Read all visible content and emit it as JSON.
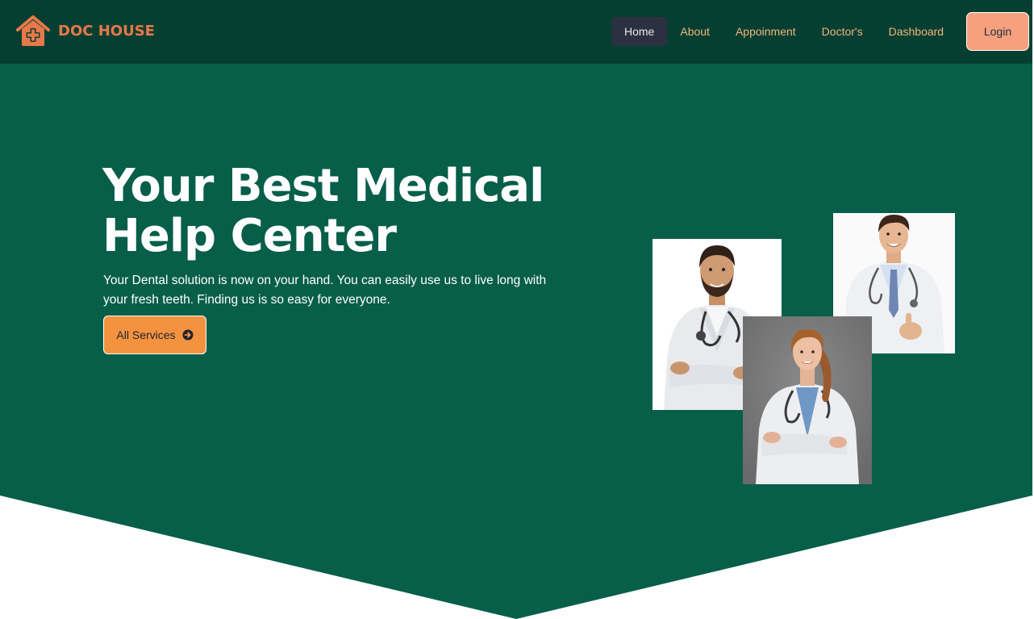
{
  "brand": {
    "name": "DOC HOUSE",
    "logo_icon": "house-plus-icon"
  },
  "nav": {
    "items": [
      {
        "label": "Home",
        "active": true
      },
      {
        "label": "About",
        "active": false
      },
      {
        "label": "Appoinment",
        "active": false
      },
      {
        "label": "Doctor's",
        "active": false
      },
      {
        "label": "Dashboard",
        "active": false
      }
    ],
    "login_label": "Login"
  },
  "hero": {
    "title_line1": "Your Best Medical",
    "title_line2": "Help Center",
    "description": "Your Dental solution is now on your hand. You can easily use us to live long with your fresh teeth. Finding us is so easy for everyone.",
    "button_label": "All Services",
    "button_icon": "arrow-circle-right-icon"
  },
  "colors": {
    "navbar_bg": "#063f31",
    "hero_bg": "#075e49",
    "brand_orange": "#e8784a",
    "nav_text": "#f2b37f",
    "login_bg": "#f6a07e",
    "services_bg": "#f4933f",
    "active_nav_bg": "#2b3140"
  },
  "images": [
    {
      "subject": "male doctor with beard, arms crossed"
    },
    {
      "subject": "young male doctor giving thumbs up"
    },
    {
      "subject": "female doctor with ponytail, arms crossed"
    }
  ]
}
